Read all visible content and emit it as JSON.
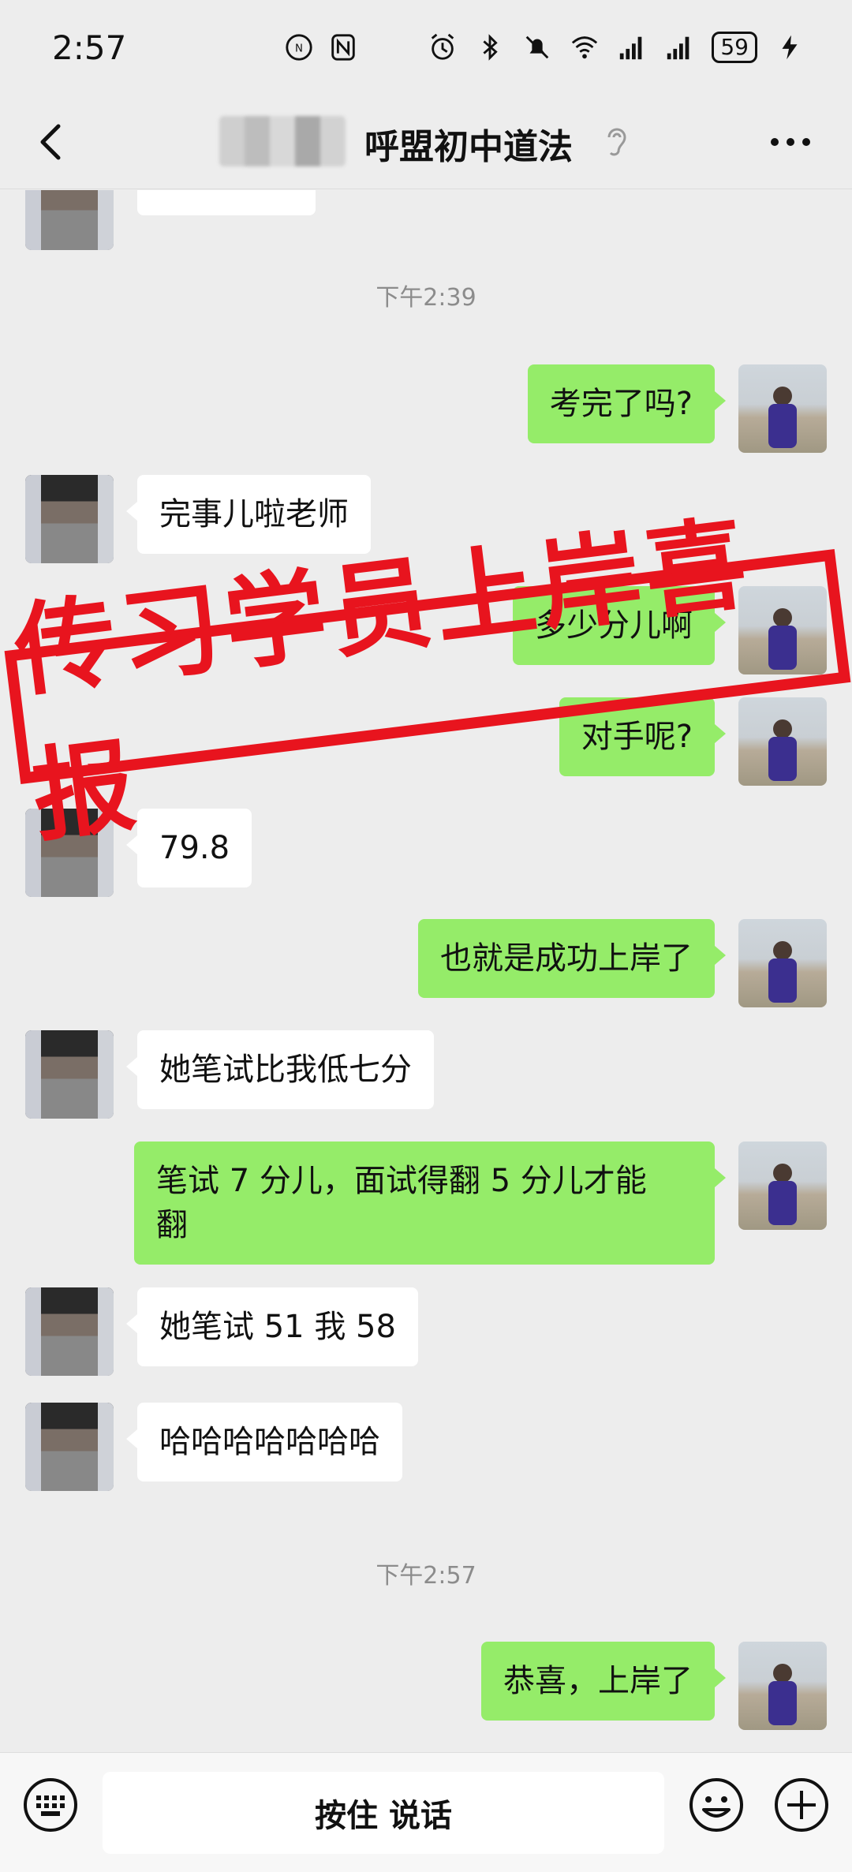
{
  "status_bar": {
    "time": "2:57",
    "battery": "59",
    "icons": [
      "nfc-badge-icon",
      "nfc-icon",
      "alarm-icon",
      "bluetooth-icon",
      "mute-icon",
      "wifi-icon",
      "signal-icon",
      "signal-icon",
      "battery-icon",
      "charging-icon"
    ]
  },
  "header": {
    "title": "呼盟初中道法",
    "back_icon": "chevron-left-icon",
    "ear_icon": "ear-icon",
    "more_icon": "more-dots-icon"
  },
  "messages": {
    "ts1": "下午2:39",
    "m1": "考完了吗?",
    "m2": "完事儿啦老师",
    "m3": "多少分儿啊",
    "m4": "对手呢?",
    "m5": "79.8",
    "m6": "也就是成功上岸了",
    "m7": "她笔试比我低七分",
    "m8": "笔试 7 分儿，面试得翻 5 分儿才能\n翻",
    "m9": "她笔试 51 我 58",
    "m10": "哈哈哈哈哈哈哈",
    "ts2": "下午2:57",
    "m11": "恭喜，上岸了"
  },
  "stamp": {
    "text": "传习学员上岸喜报",
    "color": "#e8141e"
  },
  "input_bar": {
    "talk_label": "按住 说话",
    "keyboard_icon": "keyboard-icon",
    "emoji_icon": "emoji-icon",
    "plus_icon": "plus-circle-icon"
  },
  "colors": {
    "background": "#ededed",
    "outgoing_bubble": "#95ec69",
    "incoming_bubble": "#ffffff"
  }
}
